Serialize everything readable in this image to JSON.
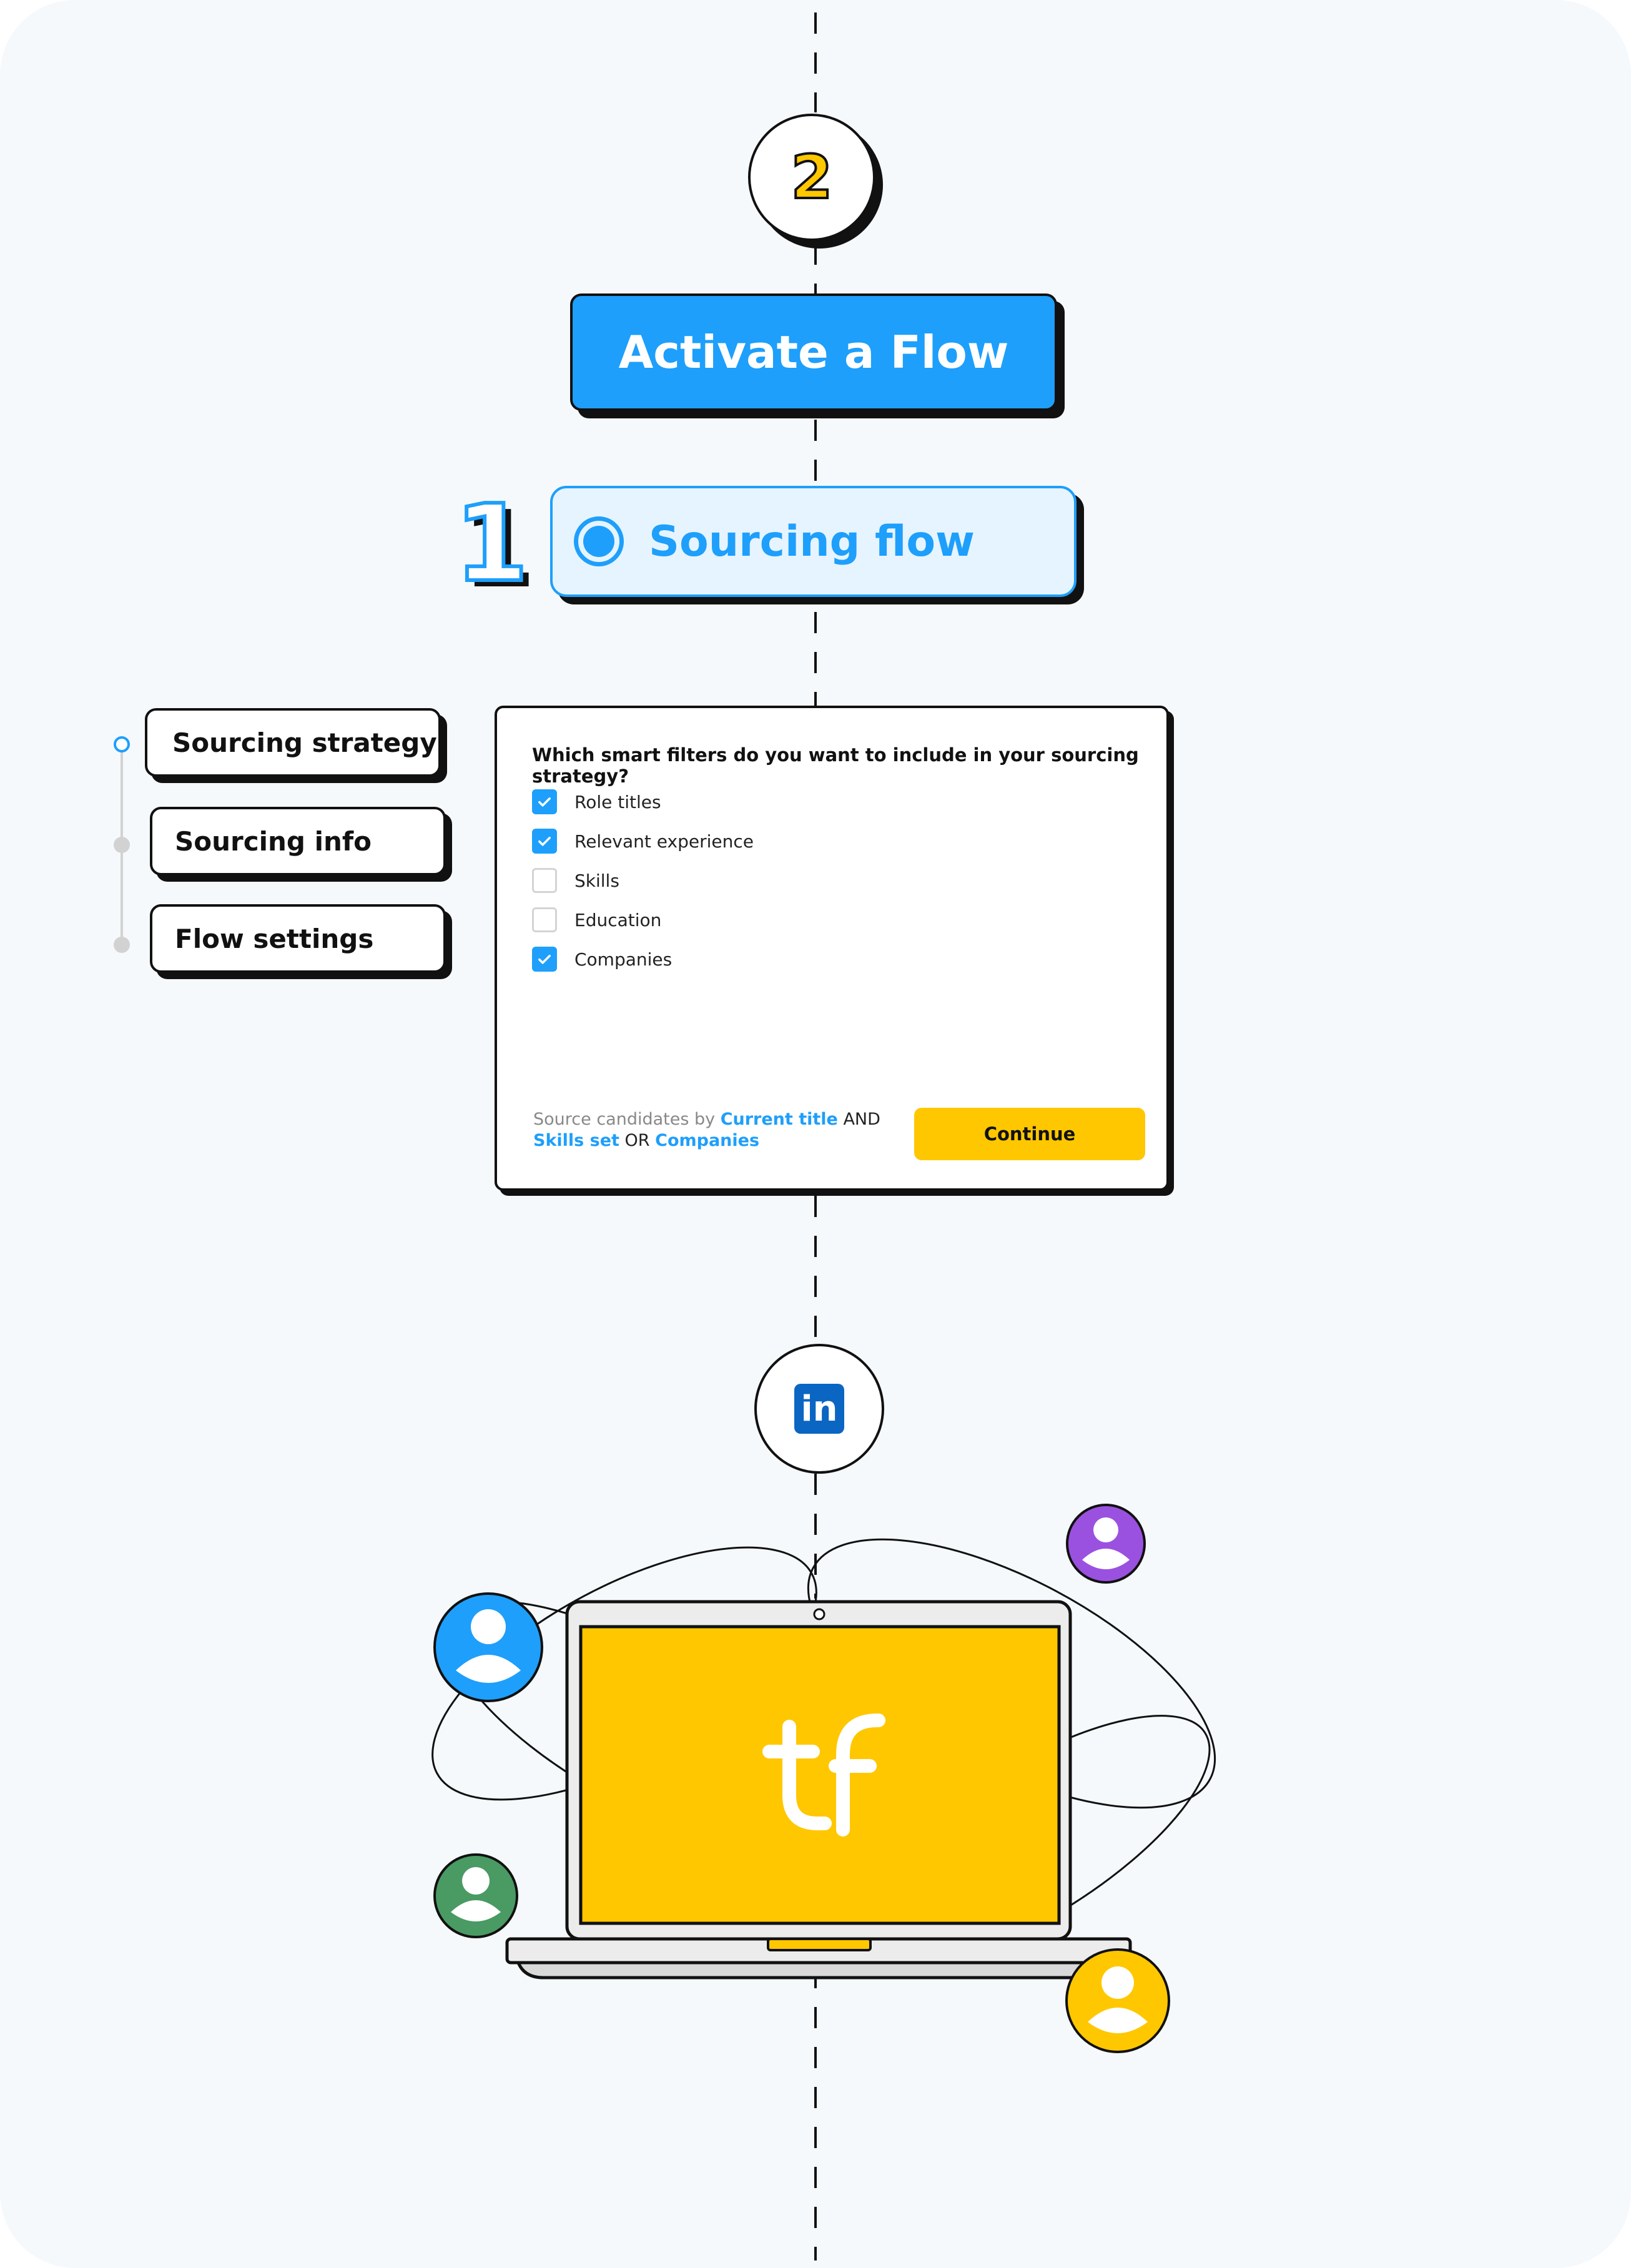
{
  "step2": {
    "number": "2"
  },
  "activate": {
    "label": "Activate a Flow"
  },
  "step1": {
    "number": "1"
  },
  "sourcing_flow": {
    "label": "Sourcing flow"
  },
  "sidebar": {
    "items": [
      {
        "label": "Sourcing strategy",
        "active": true
      },
      {
        "label": "Sourcing info",
        "active": false
      },
      {
        "label": "Flow settings",
        "active": false
      }
    ]
  },
  "card": {
    "question": "Which smart filters do you want to include in your sourcing strategy?",
    "options": [
      {
        "label": "Role titles",
        "checked": true
      },
      {
        "label": "Relevant experience",
        "checked": true
      },
      {
        "label": "Skills",
        "checked": false
      },
      {
        "label": "Education",
        "checked": false
      },
      {
        "label": "Companies",
        "checked": true
      }
    ],
    "summary": {
      "prefix": "Source candidates by",
      "term1": "Current title",
      "op1": "AND",
      "term2": "Skills set",
      "op2": "OR",
      "term3": "Companies"
    },
    "continue_label": "Continue"
  },
  "linkedin": {
    "text": "in"
  },
  "laptop": {
    "logo_text": "tf"
  },
  "colors": {
    "accent_blue": "#1e9ffb",
    "yellow": "#ffc700",
    "purple": "#9b51e0",
    "green": "#4a9a63",
    "linkedin_blue": "#0a66c2",
    "background": "#f5f9fc"
  }
}
